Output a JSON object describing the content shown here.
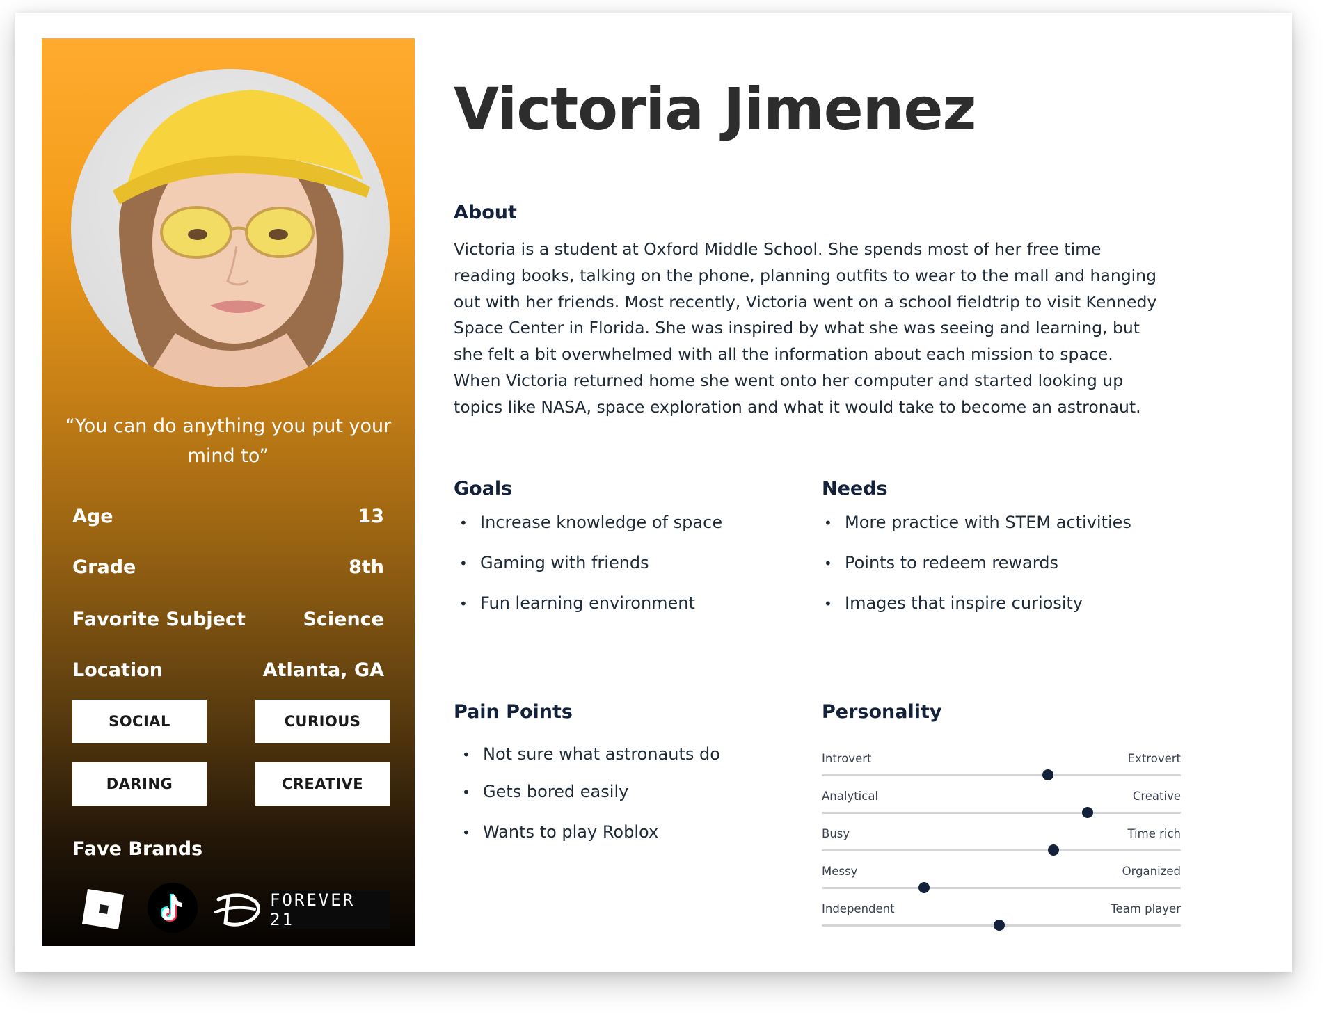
{
  "persona": {
    "name": "Victoria Jimenez",
    "quote": "“You can do anything you put your mind to”",
    "attributes": [
      {
        "label": "Age",
        "value": "13"
      },
      {
        "label": "Grade",
        "value": "8th"
      },
      {
        "label": "Favorite Subject",
        "value": "Science"
      },
      {
        "label": "Location",
        "value": "Atlanta, GA"
      }
    ],
    "traits": [
      "SOCIAL",
      "CURIOUS",
      "DARING",
      "CREATIVE"
    ],
    "fave_brands": {
      "title": "Fave Brands",
      "items": [
        {
          "name": "roblox-icon"
        },
        {
          "name": "tiktok-icon"
        },
        {
          "name": "disney-icon"
        },
        {
          "name": "forever21-logo",
          "text": "FOREVER 21"
        }
      ]
    }
  },
  "about": {
    "title": "About",
    "lines": [
      "Victoria is a student at Oxford Middle School. She spends most of her free time",
      "reading books, talking on the phone, planning outfits to wear to the mall and hanging",
      "out with her friends.  Most recently, Victoria went on a school fieldtrip to visit Kennedy",
      "Space Center in Florida. She was inspired by what she was seeing and learning, but",
      "she felt a bit overwhelmed with all the information about each mission to space.",
      "When Victoria returned home she went onto her computer and started looking up",
      "topics like NASA, space exploration and what it would take to become an astronaut."
    ]
  },
  "goals": {
    "title": "Goals",
    "items": [
      "Increase knowledge of space",
      "Gaming with friends",
      "Fun learning environment"
    ]
  },
  "needs": {
    "title": "Needs",
    "items": [
      "More practice with STEM activities",
      "Points to redeem rewards",
      "Images that inspire curiosity"
    ]
  },
  "pain_points": {
    "title": "Pain Points",
    "items": [
      "Not sure what astronauts do",
      "Gets bored easily",
      "Wants to play Roblox"
    ]
  },
  "personality": {
    "title": "Personality",
    "scales": [
      {
        "left": "Introvert",
        "right": "Extrovert",
        "value": 0.63
      },
      {
        "left": "Analytical",
        "right": "Creative",
        "value": 0.74
      },
      {
        "left": "Busy",
        "right": "Time rich",
        "value": 0.645
      },
      {
        "left": "Messy",
        "right": "Organized",
        "value": 0.285
      },
      {
        "left": "Independent",
        "right": "Team player",
        "value": 0.495
      }
    ]
  },
  "colors": {
    "panel_top": "#ffab2e",
    "panel_bottom": "#050302",
    "heading": "#13213a",
    "knob": "#14213a"
  }
}
